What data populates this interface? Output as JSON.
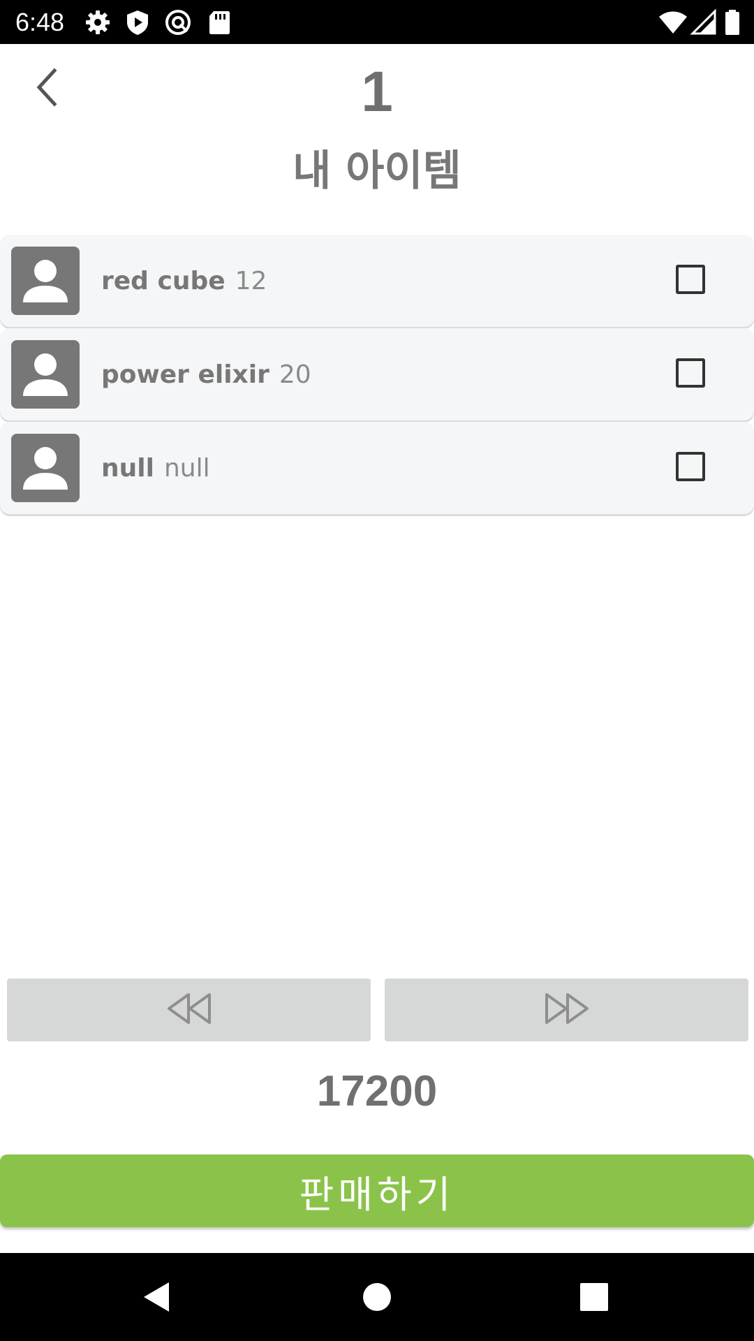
{
  "status_bar": {
    "time": "6:48",
    "icons": [
      "gear-icon",
      "shield-play-icon",
      "at-sign-icon",
      "sd-card-icon",
      "wifi-icon",
      "signal-icon",
      "battery-icon"
    ]
  },
  "header": {
    "back_icon": "chevron-left-icon",
    "page_number": "1",
    "title": "내 아이템"
  },
  "items": [
    {
      "name": "red cube",
      "quantity": "12",
      "icon": "person-avatar-icon",
      "checked": false
    },
    {
      "name": "power elixir",
      "quantity": "20",
      "icon": "person-avatar-icon",
      "checked": false
    },
    {
      "name": "null",
      "quantity": "null",
      "icon": "person-avatar-icon",
      "checked": false
    }
  ],
  "pager": {
    "prev_icon": "rewind-icon",
    "next_icon": "fast-forward-icon"
  },
  "total": "17200",
  "sell_button": {
    "label": "판매하기"
  },
  "nav_bar": {
    "icons": [
      "back-triangle-icon",
      "home-circle-icon",
      "recents-square-icon"
    ]
  },
  "colors": {
    "accent_green": "#8bc34a",
    "pager_gray": "#d6d7d7",
    "row_background": "#f5f6f8",
    "text_gray": "#777777"
  }
}
